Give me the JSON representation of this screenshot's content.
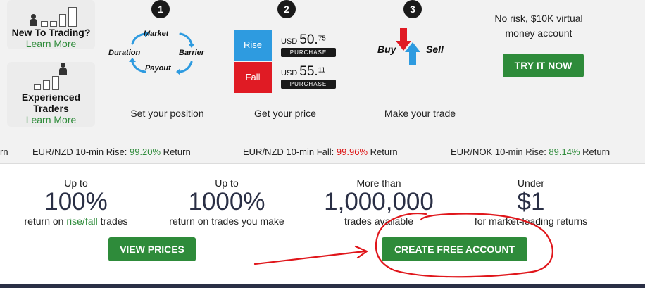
{
  "side_cards": [
    {
      "title": "New To Trading?",
      "link": "Learn More"
    },
    {
      "title_line1": "Experienced",
      "title_line2": "Traders",
      "link": "Learn More"
    }
  ],
  "steps": [
    {
      "number": "1",
      "label": "Set your position",
      "cycle": [
        "Market",
        "Duration",
        "Barrier",
        "Payout"
      ]
    },
    {
      "number": "2",
      "label": "Get your price"
    },
    {
      "number": "3",
      "label": "Make your trade",
      "buy": "Buy",
      "sell": "Sell"
    }
  ],
  "price_panel": {
    "rise": {
      "label": "Rise",
      "currency": "USD",
      "main": "50.",
      "cents": "75",
      "button": "PURCHASE"
    },
    "fall": {
      "label": "Fall",
      "currency": "USD",
      "main": "55.",
      "cents": "11",
      "button": "PURCHASE"
    }
  },
  "promo": {
    "text_line1": "No risk, $10K virtual",
    "text_line2": "money account",
    "button": "TRY IT NOW"
  },
  "ticker": [
    {
      "prefix": "rn",
      "pct": "",
      "suffix": ""
    },
    {
      "prefix": "EUR/NZD  10-min Rise: ",
      "pct": "99.20%",
      "suffix": " Return",
      "color": "#2e8b3a"
    },
    {
      "prefix": "EUR/NZD  10-min Fall: ",
      "pct": "99.96%",
      "suffix": " Return",
      "color": "#dd1111"
    },
    {
      "prefix": "EUR/NOK  10-min Rise: ",
      "pct": "89.14%",
      "suffix": " Return",
      "color": "#2e8b3a"
    }
  ],
  "stats": [
    {
      "pre": "Up to",
      "num": "100%",
      "post_a": "return on ",
      "post_link": "rise/fall",
      "post_b": " trades"
    },
    {
      "pre": "Up to",
      "num": "1000%",
      "post": "return on trades you make"
    },
    {
      "pre": "More than",
      "num": "1,000,000",
      "post": "trades available"
    },
    {
      "pre": "Under",
      "num": "$1",
      "post": "for market-leading returns"
    }
  ],
  "buttons": {
    "view_prices": "VIEW PRICES",
    "create_account": "CREATE FREE ACCOUNT"
  },
  "colors": {
    "green": "#2e8b3a",
    "red": "#dd1111",
    "navy": "#2a2f45",
    "blue": "#2e9be0",
    "annotation": "#e0161b"
  }
}
